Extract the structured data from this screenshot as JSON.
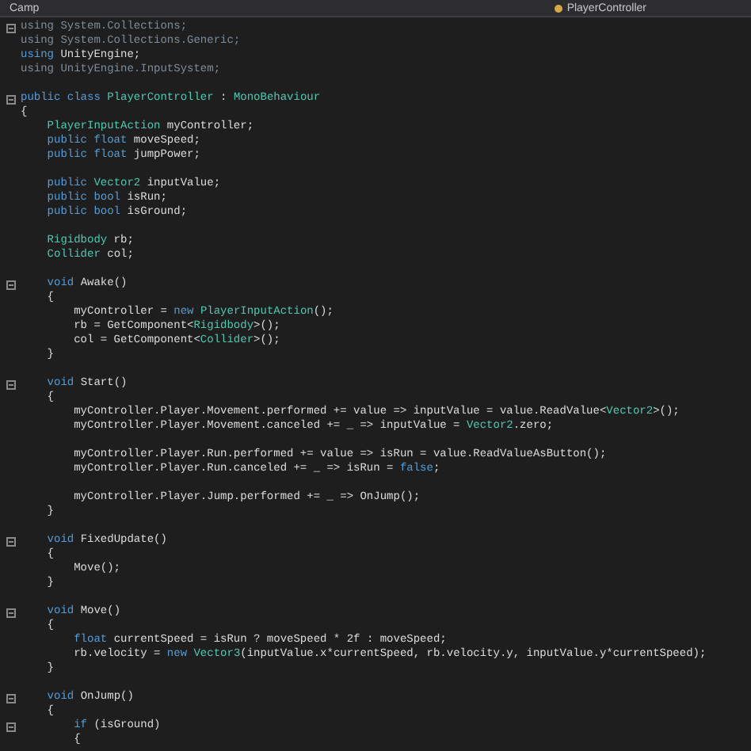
{
  "tab_bar": {
    "project": "Camp",
    "file_tab": "PlayerController"
  },
  "lines": [
    {
      "kind": "code",
      "fold": true,
      "tokens": [
        {
          "kind": "dim",
          "text": "using System.Collections;"
        }
      ]
    },
    {
      "kind": "code",
      "fold": false,
      "tokens": [
        {
          "kind": "dim",
          "text": "using System.Collections.Generic;"
        }
      ]
    },
    {
      "kind": "code",
      "fold": false,
      "tokens": [
        {
          "kind": "keyword",
          "text": "using"
        },
        {
          "kind": "plain",
          "text": " UnityEngine;"
        }
      ]
    },
    {
      "kind": "code",
      "fold": false,
      "tokens": [
        {
          "kind": "dim",
          "text": "using UnityEngine.InputSystem;"
        }
      ]
    },
    {
      "kind": "blank"
    },
    {
      "kind": "code",
      "fold": true,
      "tokens": [
        {
          "kind": "keyword",
          "text": "public class "
        },
        {
          "kind": "type",
          "text": "PlayerController"
        },
        {
          "kind": "plain",
          "text": " : "
        },
        {
          "kind": "type",
          "text": "MonoBehaviour"
        }
      ]
    },
    {
      "kind": "code",
      "fold": false,
      "tokens": [
        {
          "kind": "plain",
          "text": "{"
        }
      ]
    },
    {
      "kind": "code",
      "fold": false,
      "tokens": [
        {
          "kind": "type",
          "text": "    PlayerInputAction"
        },
        {
          "kind": "plain",
          "text": " myController;"
        }
      ]
    },
    {
      "kind": "code",
      "fold": false,
      "tokens": [
        {
          "kind": "keyword",
          "text": "    public float"
        },
        {
          "kind": "plain",
          "text": " moveSpeed;"
        }
      ]
    },
    {
      "kind": "code",
      "fold": false,
      "tokens": [
        {
          "kind": "keyword",
          "text": "    public float"
        },
        {
          "kind": "plain",
          "text": " jumpPower;"
        }
      ]
    },
    {
      "kind": "blank"
    },
    {
      "kind": "code",
      "fold": false,
      "tokens": [
        {
          "kind": "keyword",
          "text": "    public "
        },
        {
          "kind": "type",
          "text": "Vector2"
        },
        {
          "kind": "plain",
          "text": " inputValue;"
        }
      ]
    },
    {
      "kind": "code",
      "fold": false,
      "tokens": [
        {
          "kind": "keyword",
          "text": "    public bool"
        },
        {
          "kind": "plain",
          "text": " isRun;"
        }
      ]
    },
    {
      "kind": "code",
      "fold": false,
      "tokens": [
        {
          "kind": "keyword",
          "text": "    public bool"
        },
        {
          "kind": "plain",
          "text": " isGround;"
        }
      ]
    },
    {
      "kind": "blank"
    },
    {
      "kind": "code",
      "fold": false,
      "tokens": [
        {
          "kind": "type",
          "text": "    Rigidbody"
        },
        {
          "kind": "plain",
          "text": " rb;"
        }
      ]
    },
    {
      "kind": "code",
      "fold": false,
      "tokens": [
        {
          "kind": "type",
          "text": "    Collider"
        },
        {
          "kind": "plain",
          "text": " col;"
        }
      ]
    },
    {
      "kind": "blank"
    },
    {
      "kind": "code",
      "fold": true,
      "tokens": [
        {
          "kind": "keyword",
          "text": "    void "
        },
        {
          "kind": "plain",
          "text": "Awake()"
        }
      ]
    },
    {
      "kind": "code",
      "fold": false,
      "tokens": [
        {
          "kind": "plain",
          "text": "    {"
        }
      ]
    },
    {
      "kind": "code",
      "fold": false,
      "tokens": [
        {
          "kind": "plain",
          "text": "        myController = "
        },
        {
          "kind": "keyword",
          "text": "new "
        },
        {
          "kind": "type",
          "text": "PlayerInputAction"
        },
        {
          "kind": "plain",
          "text": "();"
        }
      ]
    },
    {
      "kind": "code",
      "fold": false,
      "tokens": [
        {
          "kind": "plain",
          "text": "        rb = GetComponent<"
        },
        {
          "kind": "type",
          "text": "Rigidbody"
        },
        {
          "kind": "plain",
          "text": ">();"
        }
      ]
    },
    {
      "kind": "code",
      "fold": false,
      "tokens": [
        {
          "kind": "plain",
          "text": "        col = GetComponent<"
        },
        {
          "kind": "type",
          "text": "Collider"
        },
        {
          "kind": "plain",
          "text": ">();"
        }
      ]
    },
    {
      "kind": "code",
      "fold": false,
      "tokens": [
        {
          "kind": "plain",
          "text": "    }"
        }
      ]
    },
    {
      "kind": "blank"
    },
    {
      "kind": "code",
      "fold": true,
      "tokens": [
        {
          "kind": "keyword",
          "text": "    void "
        },
        {
          "kind": "plain",
          "text": "Start()"
        }
      ]
    },
    {
      "kind": "code",
      "fold": false,
      "tokens": [
        {
          "kind": "plain",
          "text": "    {"
        }
      ]
    },
    {
      "kind": "code",
      "fold": false,
      "tokens": [
        {
          "kind": "plain",
          "text": "        myController.Player.Movement.performed += value => inputValue = value.ReadValue<"
        },
        {
          "kind": "type",
          "text": "Vector2"
        },
        {
          "kind": "plain",
          "text": ">();"
        }
      ]
    },
    {
      "kind": "code",
      "fold": false,
      "tokens": [
        {
          "kind": "plain",
          "text": "        myController.Player.Movement.canceled += _ => inputValue = "
        },
        {
          "kind": "type",
          "text": "Vector2"
        },
        {
          "kind": "plain",
          "text": ".zero;"
        }
      ]
    },
    {
      "kind": "blank"
    },
    {
      "kind": "code",
      "fold": false,
      "tokens": [
        {
          "kind": "plain",
          "text": "        myController.Player.Run.performed += value => isRun = value.ReadValueAsButton();"
        }
      ]
    },
    {
      "kind": "code",
      "fold": false,
      "tokens": [
        {
          "kind": "plain",
          "text": "        myController.Player.Run.canceled += _ => isRun = "
        },
        {
          "kind": "keyword",
          "text": "false"
        },
        {
          "kind": "plain",
          "text": ";"
        }
      ]
    },
    {
      "kind": "blank"
    },
    {
      "kind": "code",
      "fold": false,
      "tokens": [
        {
          "kind": "plain",
          "text": "        myController.Player.Jump.performed += _ => OnJump();"
        }
      ]
    },
    {
      "kind": "code",
      "fold": false,
      "tokens": [
        {
          "kind": "plain",
          "text": "    }"
        }
      ]
    },
    {
      "kind": "blank"
    },
    {
      "kind": "code",
      "fold": true,
      "tokens": [
        {
          "kind": "keyword",
          "text": "    void "
        },
        {
          "kind": "plain",
          "text": "FixedUpdate()"
        }
      ]
    },
    {
      "kind": "code",
      "fold": false,
      "tokens": [
        {
          "kind": "plain",
          "text": "    {"
        }
      ]
    },
    {
      "kind": "code",
      "fold": false,
      "tokens": [
        {
          "kind": "plain",
          "text": "        Move();"
        }
      ]
    },
    {
      "kind": "code",
      "fold": false,
      "tokens": [
        {
          "kind": "plain",
          "text": "    }"
        }
      ]
    },
    {
      "kind": "blank"
    },
    {
      "kind": "code",
      "fold": true,
      "tokens": [
        {
          "kind": "keyword",
          "text": "    void "
        },
        {
          "kind": "plain",
          "text": "Move()"
        }
      ]
    },
    {
      "kind": "code",
      "fold": false,
      "tokens": [
        {
          "kind": "plain",
          "text": "    {"
        }
      ]
    },
    {
      "kind": "code",
      "fold": false,
      "tokens": [
        {
          "kind": "keyword",
          "text": "        float "
        },
        {
          "kind": "plain",
          "text": "currentSpeed = isRun ? moveSpeed * 2f : moveSpeed;"
        }
      ]
    },
    {
      "kind": "code",
      "fold": false,
      "tokens": [
        {
          "kind": "plain",
          "text": "        rb.velocity = "
        },
        {
          "kind": "keyword",
          "text": "new "
        },
        {
          "kind": "type",
          "text": "Vector3"
        },
        {
          "kind": "plain",
          "text": "(inputValue.x*currentSpeed, rb.velocity.y, inputValue.y*currentSpeed);"
        }
      ]
    },
    {
      "kind": "code",
      "fold": false,
      "tokens": [
        {
          "kind": "plain",
          "text": "    }"
        }
      ]
    },
    {
      "kind": "blank"
    },
    {
      "kind": "code",
      "fold": true,
      "tokens": [
        {
          "kind": "keyword",
          "text": "    void "
        },
        {
          "kind": "plain",
          "text": "OnJump()"
        }
      ]
    },
    {
      "kind": "code",
      "fold": false,
      "tokens": [
        {
          "kind": "plain",
          "text": "    {"
        }
      ]
    },
    {
      "kind": "code",
      "fold": true,
      "tokens": [
        {
          "kind": "keyword",
          "text": "        if "
        },
        {
          "kind": "plain",
          "text": "(isGround)"
        }
      ]
    },
    {
      "kind": "code",
      "fold": false,
      "tokens": [
        {
          "kind": "plain",
          "text": "        {"
        }
      ]
    }
  ]
}
